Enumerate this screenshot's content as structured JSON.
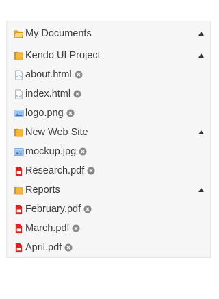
{
  "panelbar": {
    "root": {
      "label": "My Documents",
      "icon": "folder-open-icon",
      "expanded": true
    },
    "groups": [
      {
        "label": "Kendo UI Project",
        "icon": "folder-icon",
        "expanded": true,
        "items": [
          {
            "label": "about.html",
            "icon": "html-file-icon"
          },
          {
            "label": "index.html",
            "icon": "html-file-icon"
          },
          {
            "label": "logo.png",
            "icon": "image-file-icon"
          }
        ]
      },
      {
        "label": "New Web Site",
        "icon": "folder-icon",
        "expanded": true,
        "items": [
          {
            "label": "mockup.jpg",
            "icon": "image-file-icon"
          },
          {
            "label": "Research.pdf",
            "icon": "pdf-file-icon"
          }
        ]
      },
      {
        "label": "Reports",
        "icon": "folder-icon",
        "expanded": true,
        "items": [
          {
            "label": "February.pdf",
            "icon": "pdf-file-icon"
          },
          {
            "label": "March.pdf",
            "icon": "pdf-file-icon"
          },
          {
            "label": "April.pdf",
            "icon": "pdf-file-icon"
          }
        ]
      }
    ]
  },
  "colors": {
    "panel_background": "#f6f6f6",
    "text": "#3d3d3d",
    "remove_icon": "#8a8a8a",
    "folder": "#e8a82e",
    "pdf": "#d9231c",
    "image": "#3b6fb5"
  }
}
